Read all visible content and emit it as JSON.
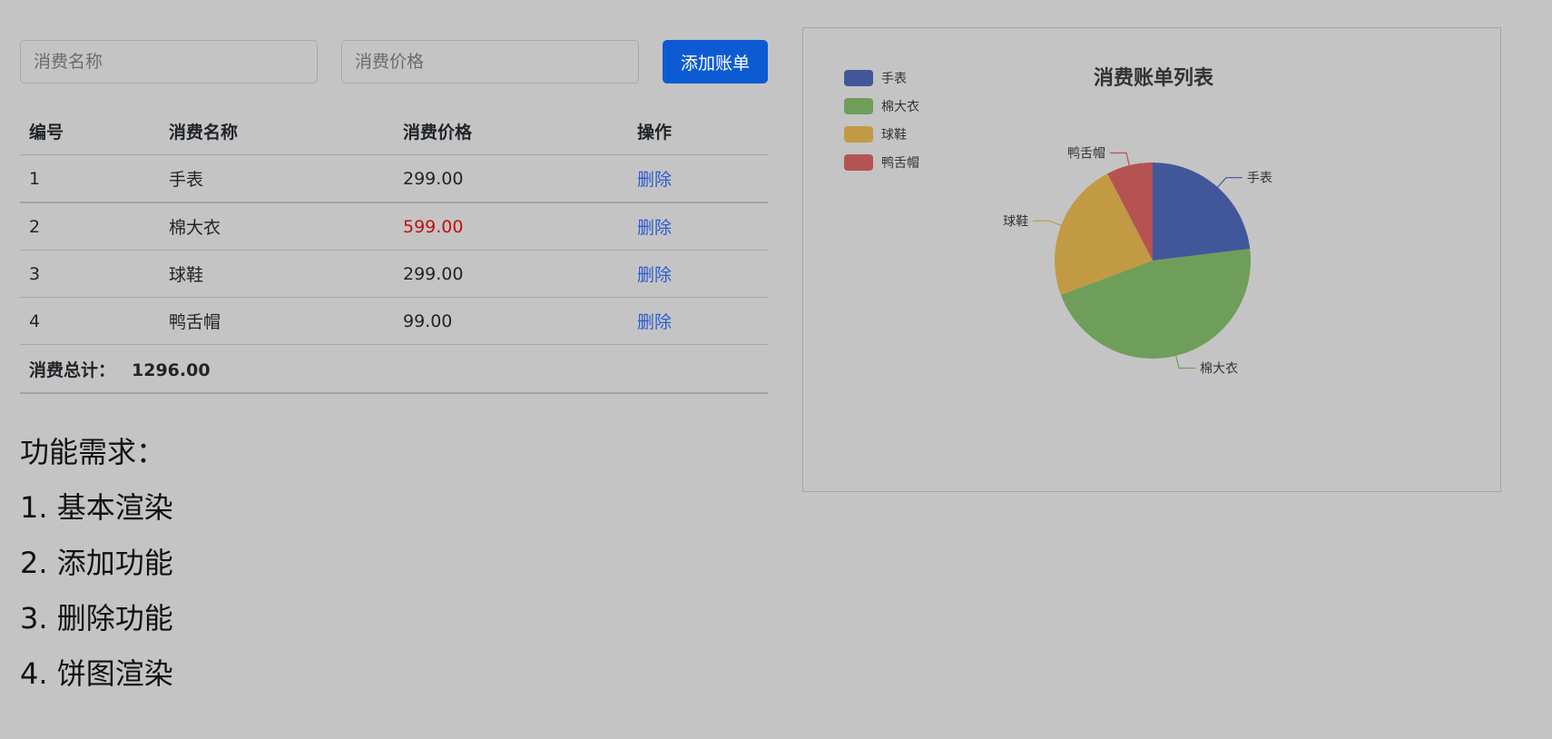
{
  "form": {
    "name_placeholder": "消费名称",
    "price_placeholder": "消费价格",
    "add_label": "添加账单"
  },
  "table": {
    "headers": [
      "编号",
      "消费名称",
      "消费价格",
      "操作"
    ],
    "rows": [
      {
        "id": "1",
        "name": "手表",
        "price": "299.00",
        "action": "删除"
      },
      {
        "id": "2",
        "name": "棉大衣",
        "price": "599.00",
        "action": "删除"
      },
      {
        "id": "3",
        "name": "球鞋",
        "price": "299.00",
        "action": "删除"
      },
      {
        "id": "4",
        "name": "鸭舌帽",
        "price": "99.00",
        "action": "删除"
      }
    ],
    "total_label": "消费总计：",
    "total_value": "1296.00"
  },
  "requirements": {
    "title": "功能需求：",
    "items": [
      "1. 基本渲染",
      "2. 添加功能",
      "3. 删除功能",
      "4. 饼图渲染"
    ]
  },
  "colors": {
    "accent": "#0d5bd3",
    "link": "#2b5bd1",
    "highlight_price": "#c10f0f",
    "series": [
      "#41579a",
      "#6f9e5b",
      "#c29a44",
      "#b55353"
    ]
  },
  "chart_data": {
    "type": "pie",
    "title": "消费账单列表",
    "categories": [
      "手表",
      "棉大衣",
      "球鞋",
      "鸭舌帽"
    ],
    "values": [
      299,
      599,
      299,
      99
    ],
    "legend": "top-left"
  }
}
